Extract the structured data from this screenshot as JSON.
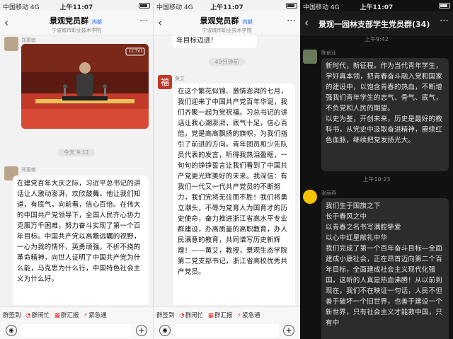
{
  "panels": [
    {
      "status": {
        "carrier": "中国移动 4G",
        "time": "上午11:07"
      },
      "header": {
        "title": "景观党员群",
        "tag": "内部",
        "subtitle": "宁波城市职业技术学院"
      },
      "messages": [
        {
          "sender": "郑惠敏",
          "type": "image",
          "caption": "CCTV1"
        },
        {
          "type": "time",
          "text": "今天 9:11"
        },
        {
          "sender": "郑惠敏",
          "type": "text",
          "text": "在建党百年大庆之际，习近平总书记的讲话让人激动澎湃，欢欣鼓舞。他让我们知道，有底气，向前看，信心百倍。在伟大的中国共产党领导下，全国人民齐心协力克服万千困难，努力奋斗实现了第一个百年目标。中国共产党以高瞻远瞩的视野，一心为我的情怀，英勇顽强，不折不挠的革命精神，向世人证明了中国共产党为什么能，马克思为什么行，中国特色社会主义为什么好。"
        }
      ],
      "tools": [
        "群签到",
        "群闲忙",
        "群汇报",
        "紧急通"
      ]
    },
    {
      "status": {
        "carrier": "中国移动 4G",
        "time": "上午11:07"
      },
      "header": {
        "title": "景观党员群",
        "tag": "内部",
        "subtitle": "宁波城市职业技术学院"
      },
      "messages": [
        {
          "type": "text_tail",
          "text": "年目标迈进！"
        },
        {
          "type": "time",
          "text": "49分钟前"
        },
        {
          "sender": "黄艾",
          "type": "text",
          "text": "在这个繁花似锦、激情澎湃的七月，我们迎来了中国共产党百年华诞，我们齐聚一起为党祝福。习总书记的讲话让我心潮澎湃，底气十足，信心百倍。党是高高飘扬的旗帜，为我们指引了前进的方向。青年团员和少先队员代表的发言，听得我热泪盈眶，一句句的铮铮誓言让我们看到了中国共产党更光辉美好的未来。我深信：有我们一代又一代共产党员的不断努力，我们党将无往而不胜！我们将勇立潮头，不辱为党育人为国育才的历史使命，奋力推进浙江省高水平专业群建设，办高质量的高职教育，办人民满意的教育，共同谱写历史新辉煌！——黄艾，教授，景观生态学院第二党支部书记，浙江省高校优秀共产党员。"
        }
      ],
      "tools": [
        "群签到",
        "群闲忙",
        "群汇报",
        "紧急通",
        "群签"
      ]
    },
    {
      "status": {
        "carrier": "中国移动 4G",
        "time": "上午11:07"
      },
      "header": {
        "title": "景观一园林支部学生党员群(34)"
      },
      "messages": [
        {
          "type": "time",
          "text": "上午9:42"
        },
        {
          "sender": "陈创业",
          "type": "text",
          "text": "新时代，新征程。作为当代青年学生，学好真本领，把青春奋斗融入党和国家的建设中，以饱含青春的热血，不断增强我们青年学生的志气、骨气、底气，不负党和人民的期望。\n以史为鉴，开创未来，历史是最好的教科书，从党史中汲取奋进精神，赓续红色血脉，继续把党发扬光大。"
        },
        {
          "type": "time",
          "text": "上午10:23"
        },
        {
          "sender": "张丽燕",
          "type": "text",
          "text": "我们生于国旗之下\n长于春风之中\n以青春之名书写满腔挚爱\n以心中红星献礼中华\n我们完成了第一个百年奋斗目标—全面建成小康社会，正在昂首迈向第二个百年目标，全面建成社会主义现代化强国，这听的人真是热血沸腾！从以前到现在，我们不在映证一句话，人民不但善于破坏一个旧世界，也善于建设一个新世界，只有社会主义才能救中国，只有中"
        }
      ]
    }
  ]
}
